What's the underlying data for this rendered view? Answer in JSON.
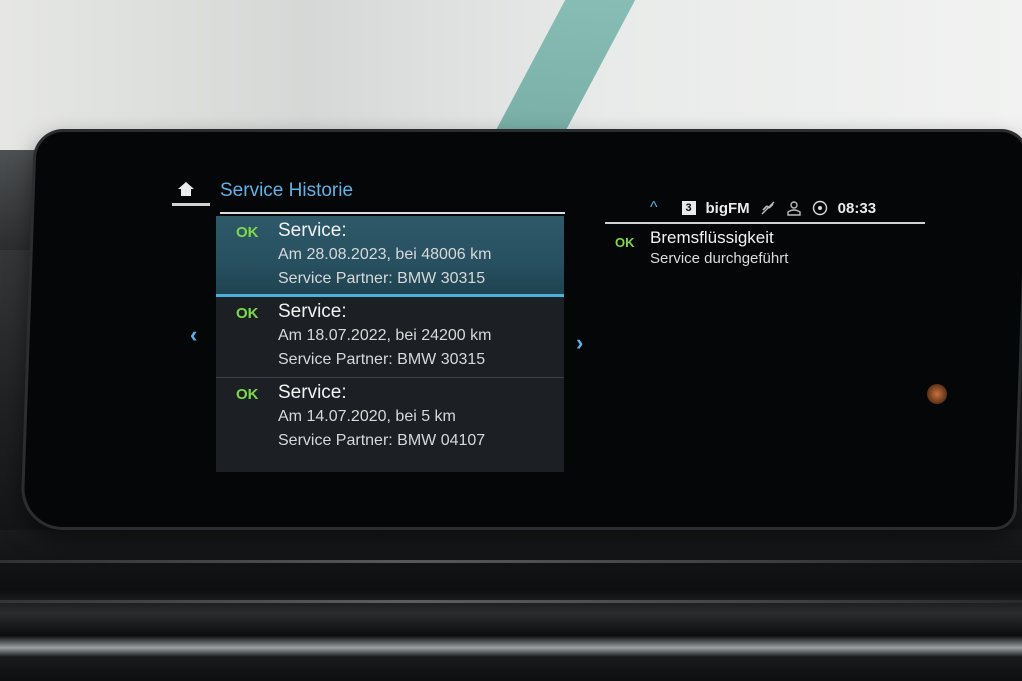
{
  "header": {
    "title": "Service Historie"
  },
  "history": [
    {
      "status": "OK",
      "heading": "Service:",
      "detail": "Am 28.08.2023, bei 48006 km",
      "partner": "Service Partner: BMW 30315",
      "selected": true
    },
    {
      "status": "OK",
      "heading": "Service:",
      "detail": "Am 18.07.2022, bei 24200 km",
      "partner": "Service Partner: BMW 30315",
      "selected": false
    },
    {
      "status": "OK",
      "heading": "Service:",
      "detail": "Am 14.07.2020, bei 5 km",
      "partner": "Service Partner: BMW 04107",
      "selected": false
    }
  ],
  "nav": {
    "prev": "‹",
    "next": "›"
  },
  "status_bar": {
    "caret": "^",
    "preset": "3",
    "station": "bigFM",
    "time": "08:33"
  },
  "detail_panel": {
    "status": "OK",
    "title": "Bremsflüssigkeit",
    "subtitle": "Service durchgeführt"
  },
  "colors": {
    "accent": "#5fb3e6",
    "ok": "#7fd84a",
    "selected_bg": "#275060"
  },
  "icons": {
    "home": "home-icon",
    "mute": "mute-icon",
    "profile": "profile-icon",
    "connectivity": "connectivity-icon"
  }
}
